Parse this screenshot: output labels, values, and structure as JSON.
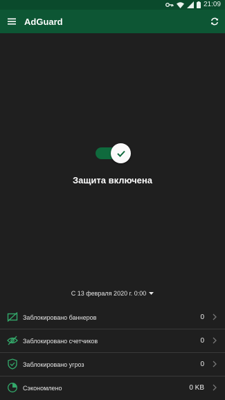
{
  "status_bar": {
    "time": "21:09"
  },
  "app_bar": {
    "title": "AdGuard"
  },
  "protection": {
    "status_text": "Защита включена",
    "enabled": true
  },
  "date_filter": {
    "label": "С 13 февраля 2020 г. 0:00"
  },
  "stats": [
    {
      "label": "Заблокировано баннеров",
      "value": "0",
      "icon": "banner-blocked-icon"
    },
    {
      "label": "Заблокировано счетчиков",
      "value": "0",
      "icon": "tracker-blocked-icon"
    },
    {
      "label": "Заблокировано угроз",
      "value": "0",
      "icon": "shield-check-icon"
    },
    {
      "label": "Сэкономлено",
      "value": "0 KB",
      "icon": "pie-chart-icon"
    }
  ],
  "colors": {
    "accent": "#0f6a3d",
    "app_bar": "#0d5634",
    "status_bar": "#0a4a2c",
    "background": "#1f1f1f",
    "icon_green": "#33a86a"
  }
}
